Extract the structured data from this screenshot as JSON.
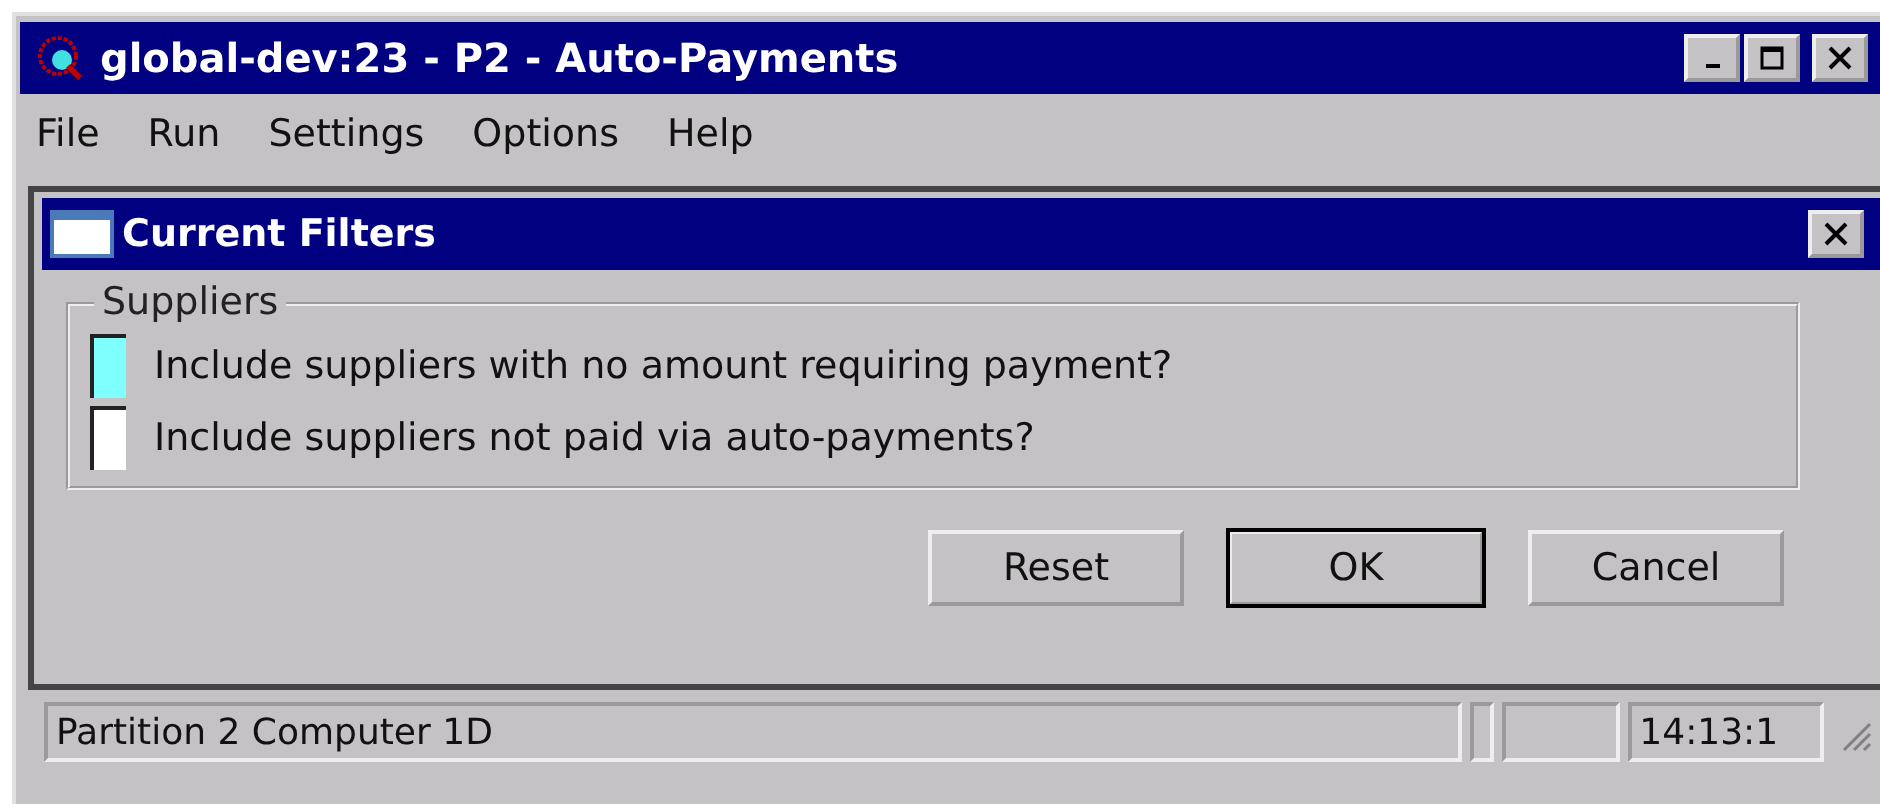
{
  "window": {
    "title": "global-dev:23 - P2 - Auto-Payments"
  },
  "menu": [
    {
      "label": "File"
    },
    {
      "label": "Run"
    },
    {
      "label": "Settings"
    },
    {
      "label": "Options"
    },
    {
      "label": "Help"
    }
  ],
  "dialog": {
    "title": "Current Filters",
    "group": "Suppliers",
    "options": [
      {
        "label": "Include suppliers with no amount requiring payment?",
        "checked": false,
        "focused": true
      },
      {
        "label": "Include suppliers not paid via auto-payments?",
        "checked": false,
        "focused": false
      }
    ],
    "buttons": [
      {
        "label": "Reset",
        "default": false
      },
      {
        "label": "OK",
        "default": true
      },
      {
        "label": "Cancel",
        "default": false
      }
    ]
  },
  "status_bar": {
    "text": "Partition 2 Computer 1D",
    "time": "14:13:1"
  }
}
